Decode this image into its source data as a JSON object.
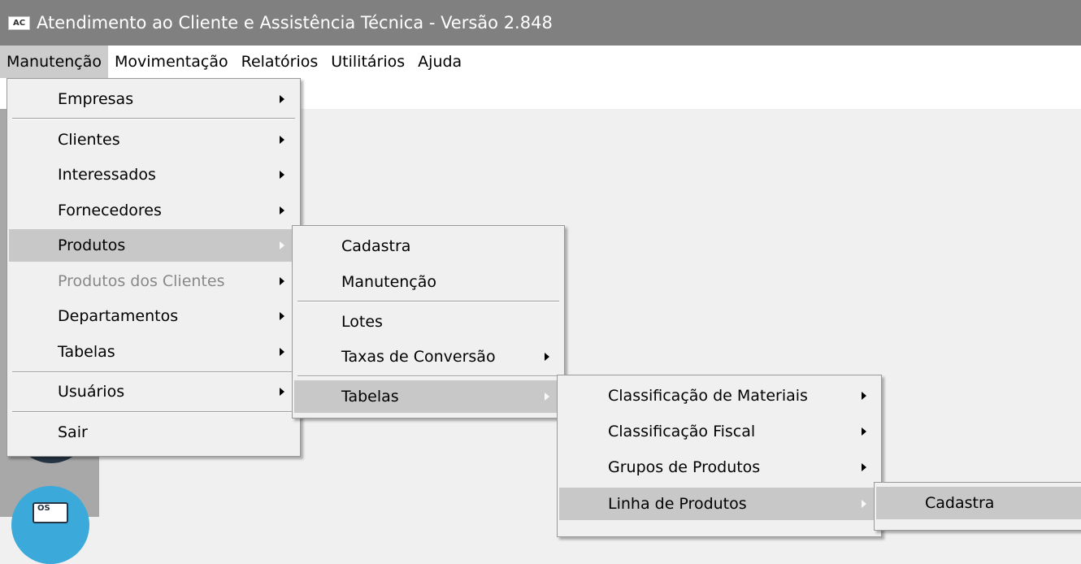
{
  "window": {
    "icon_text": "AC",
    "title": "Atendimento ao Cliente e Assistência Técnica - Versão 2.848"
  },
  "menubar": [
    "Manutenção",
    "Movimentação",
    "Relatórios",
    "Utilitários",
    "Ajuda"
  ],
  "menu1": {
    "empresas": "Empresas",
    "clientes": "Clientes",
    "interessados": "Interessados",
    "fornecedores": "Fornecedores",
    "produtos": "Produtos",
    "produtos_clientes": "Produtos dos Clientes",
    "departamentos": "Departamentos",
    "tabelas": "Tabelas",
    "usuarios": "Usuários",
    "sair": "Sair"
  },
  "menu2": {
    "cadastra": "Cadastra",
    "manutencao": "Manutenção",
    "lotes": "Lotes",
    "taxas": "Taxas de Conversão",
    "tabelas": "Tabelas"
  },
  "menu3": {
    "classificacao_materiais": "Classificação de Materiais",
    "classificacao_fiscal": "Classificação Fiscal",
    "grupos": "Grupos de Produtos",
    "linha": "Linha de Produtos"
  },
  "menu4": {
    "cadastra": "Cadastra"
  },
  "sidebar_icon_text": "OS"
}
